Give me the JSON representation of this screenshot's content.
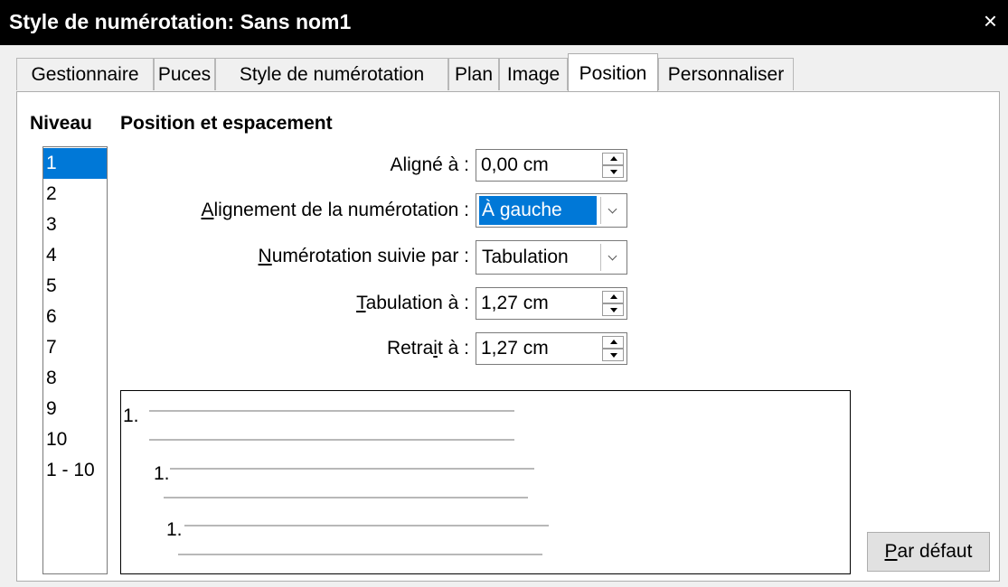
{
  "window": {
    "title": "Style de numérotation: Sans nom1",
    "close_glyph": "×"
  },
  "tabs": [
    {
      "label": "Gestionnaire"
    },
    {
      "label": "Puces"
    },
    {
      "label": "Style de numérotation"
    },
    {
      "label": "Plan"
    },
    {
      "label": "Image"
    },
    {
      "label": "Position",
      "active": true
    },
    {
      "label": "Personnaliser"
    }
  ],
  "level": {
    "header": "Niveau",
    "items": [
      "1",
      "2",
      "3",
      "4",
      "5",
      "6",
      "7",
      "8",
      "9",
      "10",
      "1 - 10"
    ],
    "selected": "1"
  },
  "section": {
    "title": "Position et espacement"
  },
  "fields": {
    "aligned_at": {
      "label": "Aligné à :",
      "value": "0,00 cm"
    },
    "numbering_alignment": {
      "label_u": "A",
      "label_rest": "lignement de la numérotation :",
      "value": "À gauche"
    },
    "followed_by": {
      "label_u": "N",
      "label_rest": "umérotation suivie par :",
      "value": "Tabulation"
    },
    "tab_at": {
      "label_u": "T",
      "label_rest": "abulation à :",
      "value": "1,27 cm"
    },
    "indent_at": {
      "label_pre": "Retra",
      "label_u": "i",
      "label_rest": "t à :",
      "value": "1,27 cm"
    }
  },
  "preview": {
    "numbers": [
      "1.",
      "1.",
      "1."
    ]
  },
  "buttons": {
    "default_u": "P",
    "default_rest": "ar défaut"
  },
  "colors": {
    "selection": "#0078d7",
    "titlebar": "#000000"
  }
}
